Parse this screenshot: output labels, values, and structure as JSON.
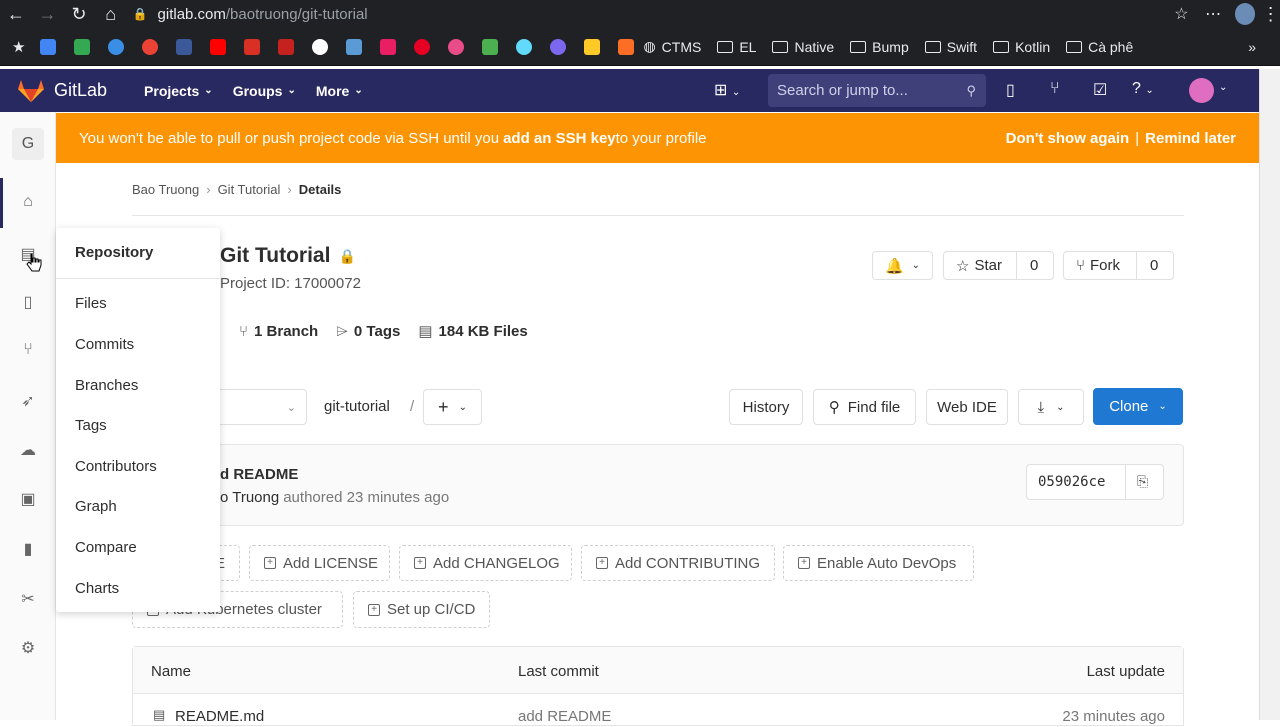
{
  "browser": {
    "url_host": "gitlab.com",
    "url_path": "/baotruong/git-tutorial",
    "bookmarks": [
      "CTMS",
      "EL",
      "Native",
      "Bump",
      "Swift",
      "Kotlin",
      "Cà phê"
    ]
  },
  "gitlab_nav": {
    "brand": "GitLab",
    "menus": [
      "Projects",
      "Groups",
      "More"
    ],
    "search_placeholder": "Search or jump to..."
  },
  "sidebar": {
    "project_avatar": "G"
  },
  "banner": {
    "text_before": "You won't be able to pull or push project code via SSH until you ",
    "link": "add an SSH key",
    "text_after": " to your profile",
    "dont_show": "Don't show again",
    "divider": "|",
    "remind": "Remind later"
  },
  "breadcrumb": {
    "items": [
      "Bao Truong",
      "Git Tutorial",
      "Details"
    ]
  },
  "flyout": {
    "title": "Repository",
    "items": [
      "Files",
      "Commits",
      "Branches",
      "Tags",
      "Contributors",
      "Graph",
      "Compare",
      "Charts"
    ]
  },
  "project": {
    "name": "Git Tutorial",
    "id_text": "Project ID: 17000072",
    "branches": "1 Branch",
    "tags": "0 Tags",
    "files": "184 KB Files",
    "star_label": "Star",
    "star_count": "0",
    "fork_label": "Fork",
    "fork_count": "0"
  },
  "repo_bar": {
    "path": "git-tutorial",
    "slash": "/",
    "history": "History",
    "find_file": "Find file",
    "web_ide": "Web IDE",
    "clone": "Clone"
  },
  "last_commit": {
    "message": "d README",
    "author": "o Truong",
    "authored": "authored 23 minutes ago",
    "sha": "059026ce"
  },
  "quick_actions": {
    "row1": [
      "E",
      "Add LICENSE",
      "Add CHANGELOG",
      "Add CONTRIBUTING",
      "Enable Auto DevOps"
    ],
    "row2": [
      "Add Kubernetes cluster",
      "Set up CI/CD"
    ]
  },
  "file_table": {
    "headers": [
      "Name",
      "Last commit",
      "Last update"
    ],
    "rows": [
      {
        "name": "README.md",
        "commit": "add README",
        "updated": "23 minutes ago"
      }
    ]
  },
  "colors": {
    "nav": "#292961",
    "banner": "#fc9403",
    "clone": "#1f78d1"
  }
}
